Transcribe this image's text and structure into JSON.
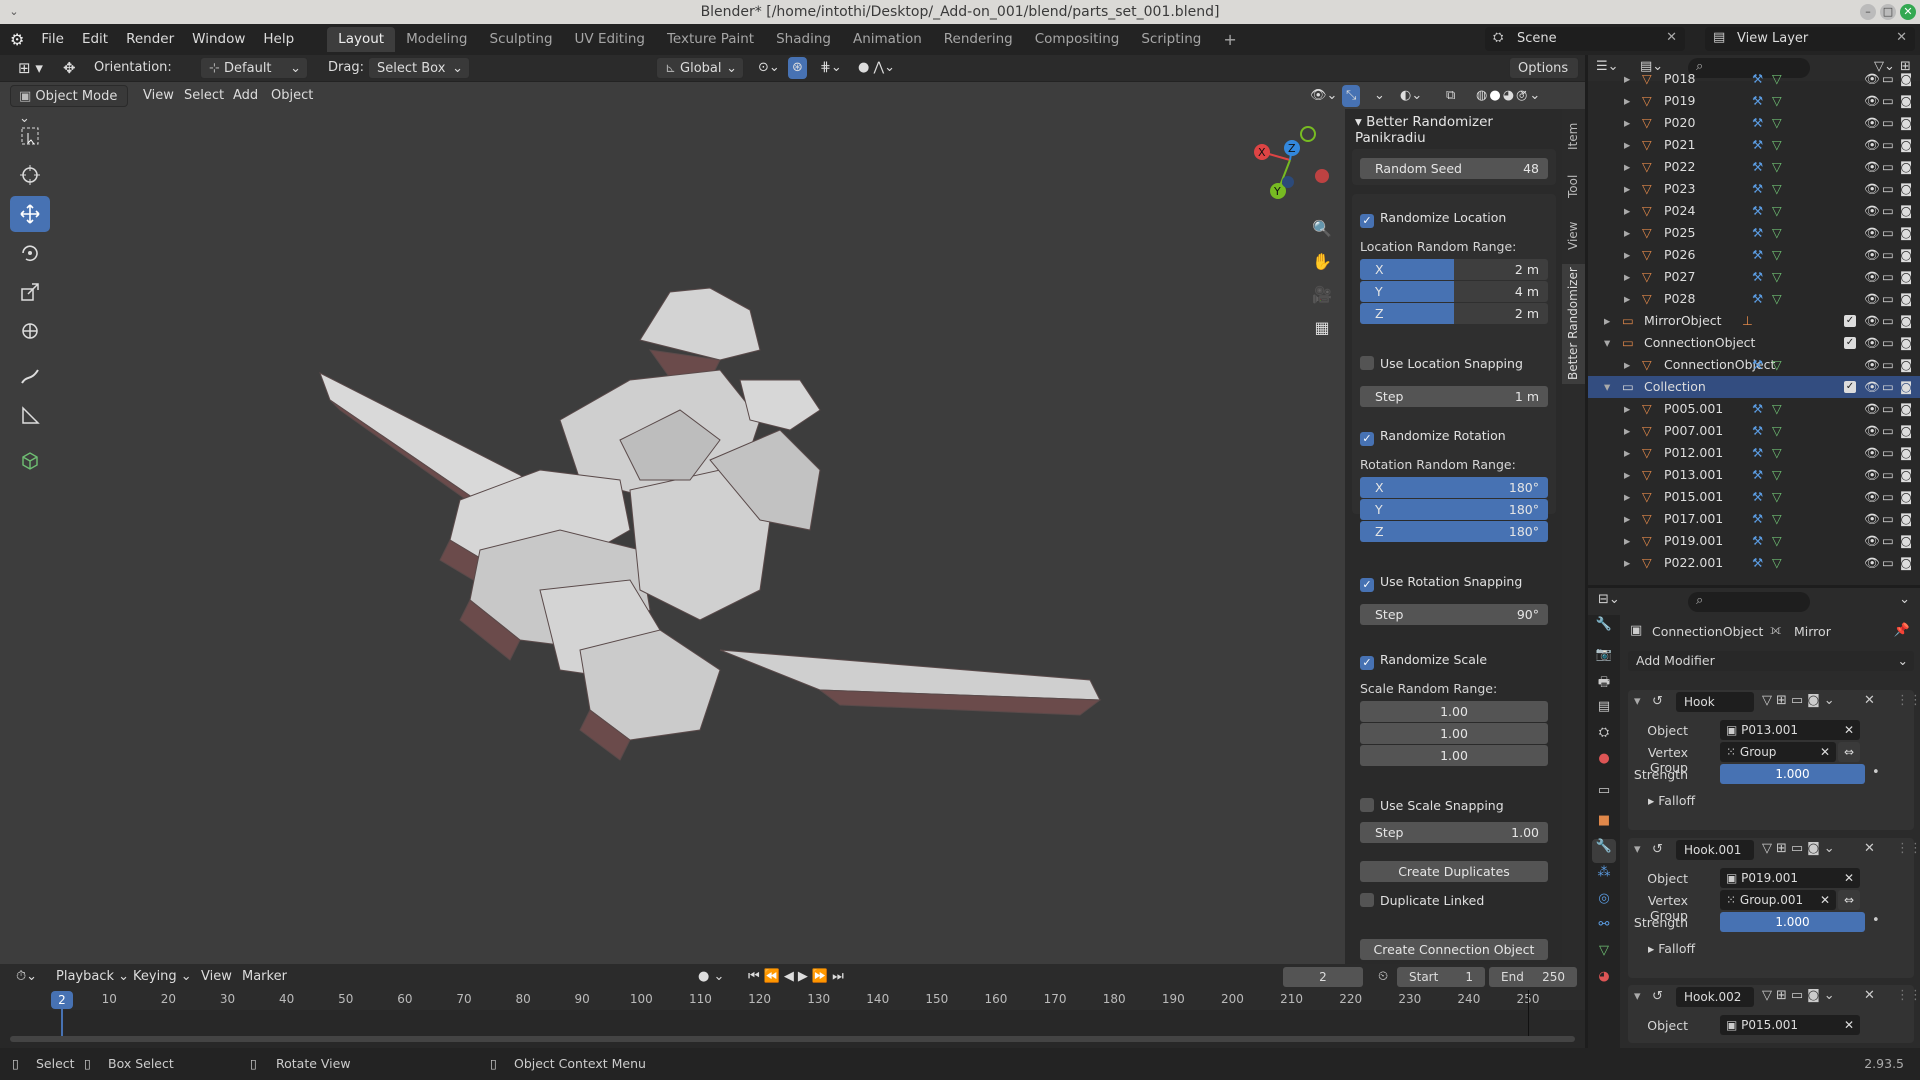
{
  "window": {
    "title": "Blender* [/home/intothi/Desktop/_Add-on_001/blend/parts_set_001.blend]"
  },
  "menus": [
    "File",
    "Edit",
    "Render",
    "Window",
    "Help"
  ],
  "workspaces": [
    "Layout",
    "Modeling",
    "Sculpting",
    "UV Editing",
    "Texture Paint",
    "Shading",
    "Animation",
    "Rendering",
    "Compositing",
    "Scripting"
  ],
  "workspace_active": "Layout",
  "scene": "Scene",
  "view_layer": "View Layer",
  "viewport_header": {
    "orientation_label": "Orientation:",
    "orientation_value": "Default",
    "drag_label": "Drag:",
    "drag_value": "Select Box",
    "transform_orientation": "Global",
    "options": "Options"
  },
  "viewport_header2": {
    "mode": "Object Mode",
    "view": "View",
    "select": "Select",
    "add": "Add",
    "object": "Object"
  },
  "gizmo": {
    "x": "X",
    "y": "Y",
    "z": "Z"
  },
  "npanel": {
    "title": "Better Randomizer Panikradiu",
    "random_seed_label": "Random Seed",
    "random_seed_value": "48",
    "randomize_location": "Randomize Location",
    "location_range_label": "Location Random Range:",
    "location": [
      {
        "axis": "X",
        "value": "2 m"
      },
      {
        "axis": "Y",
        "value": "4 m"
      },
      {
        "axis": "Z",
        "value": "2 m"
      }
    ],
    "use_location_snapping": "Use Location Snapping",
    "location_step_label": "Step",
    "location_step_value": "1 m",
    "randomize_rotation": "Randomize Rotation",
    "rotation_range_label": "Rotation Random Range:",
    "rotation": [
      {
        "axis": "X",
        "value": "180°"
      },
      {
        "axis": "Y",
        "value": "180°"
      },
      {
        "axis": "Z",
        "value": "180°"
      }
    ],
    "use_rotation_snapping": "Use Rotation Snapping",
    "rotation_step_label": "Step",
    "rotation_step_value": "90°",
    "randomize_scale": "Randomize Scale",
    "scale_range_label": "Scale Random Range:",
    "scale": [
      "1.00",
      "1.00",
      "1.00"
    ],
    "use_scale_snapping": "Use Scale Snapping",
    "scale_step_label": "Step",
    "scale_step_value": "1.00",
    "create_duplicates": "Create Duplicates",
    "duplicate_linked": "Duplicate Linked",
    "create_connection_object": "Create Connection Object",
    "tabs": [
      "Item",
      "Tool",
      "View",
      "Better Randomizer"
    ]
  },
  "outliner": {
    "rows_top": [
      "P018",
      "P019",
      "P020",
      "P021",
      "P022",
      "P023",
      "P024",
      "P025",
      "P026",
      "P027",
      "P028"
    ],
    "mirror_object": "MirrorObject",
    "connection_object_parent": "ConnectionObject",
    "connection_object_child": "ConnectionObject",
    "collection": "Collection",
    "collection_children": [
      "P005.001",
      "P007.001",
      "P012.001",
      "P013.001",
      "P015.001",
      "P017.001",
      "P019.001",
      "P022.001"
    ]
  },
  "properties": {
    "object_name": "ConnectionObject",
    "modifier_name": "Mirror",
    "add_modifier": "Add Modifier",
    "modifiers": [
      {
        "name": "Hook",
        "object_label": "Object",
        "object": "P013.001",
        "vgroup_label": "Vertex Group",
        "vgroup": "Group",
        "strength_label": "Strength",
        "strength": "1.000",
        "falloff": "Falloff"
      },
      {
        "name": "Hook.001",
        "object_label": "Object",
        "object": "P019.001",
        "vgroup_label": "Vertex Group",
        "vgroup": "Group.001",
        "strength_label": "Strength",
        "strength": "1.000",
        "falloff": "Falloff"
      },
      {
        "name": "Hook.002",
        "object_label": "Object",
        "object": "P015.001"
      }
    ]
  },
  "timeline": {
    "playback": "Playback",
    "keying": "Keying",
    "view": "View",
    "marker": "Marker",
    "current_frame": "2",
    "start_label": "Start",
    "start": "1",
    "end_label": "End",
    "end": "250",
    "ruler": [
      "10",
      "20",
      "30",
      "40",
      "50",
      "60",
      "70",
      "80",
      "90",
      "100",
      "110",
      "120",
      "130",
      "140",
      "150",
      "160",
      "170",
      "180",
      "190",
      "200",
      "210",
      "220",
      "230",
      "240",
      "250"
    ],
    "playhead": "2"
  },
  "statusbar": {
    "select": "Select",
    "box_select": "Box Select",
    "rotate_view": "Rotate View",
    "context_menu": "Object Context Menu",
    "version": "2.93.5"
  },
  "colors": {
    "accent": "#4772b3",
    "object_orange": "#e0884a",
    "mesh_green": "#6fbf73",
    "selected_row": "#334d80"
  }
}
